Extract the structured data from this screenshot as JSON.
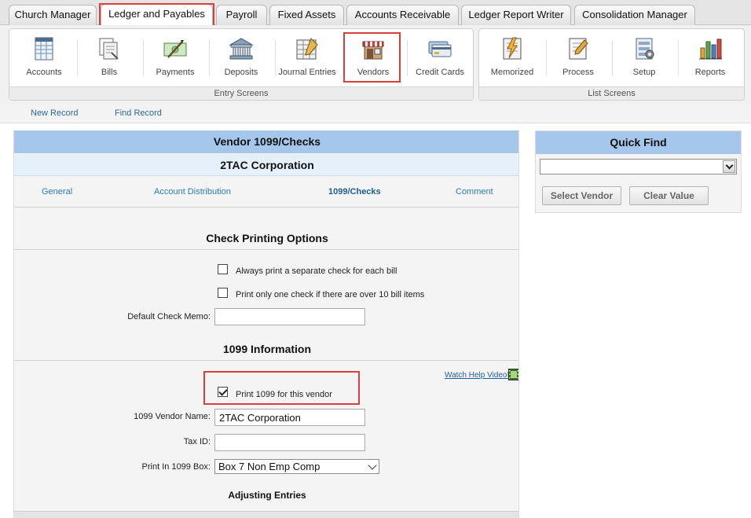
{
  "top_tabs": [
    {
      "label": "Church Manager"
    },
    {
      "label": "Ledger and Payables"
    },
    {
      "label": "Payroll"
    },
    {
      "label": "Fixed Assets"
    },
    {
      "label": "Accounts Receivable"
    },
    {
      "label": "Ledger Report Writer"
    },
    {
      "label": "Consolidation Manager"
    }
  ],
  "active_tab": "Ledger and Payables",
  "ribbon": {
    "entry_screens": {
      "label": "Entry Screens",
      "buttons": [
        {
          "label": "Accounts",
          "icon": "accounts-icon"
        },
        {
          "label": "Bills",
          "icon": "bills-icon"
        },
        {
          "label": "Payments",
          "icon": "payments-icon"
        },
        {
          "label": "Deposits",
          "icon": "deposits-icon"
        },
        {
          "label": "Journal Entries",
          "icon": "journal-entries-icon"
        },
        {
          "label": "Vendors",
          "icon": "vendors-icon"
        },
        {
          "label": "Credit Cards",
          "icon": "credit-cards-icon"
        }
      ]
    },
    "list_screens": {
      "label": "List Screens",
      "buttons": [
        {
          "label": "Memorized",
          "icon": "memorized-icon"
        },
        {
          "label": "Process",
          "icon": "process-icon"
        },
        {
          "label": "Setup",
          "icon": "setup-icon"
        },
        {
          "label": "Reports",
          "icon": "reports-icon"
        }
      ]
    }
  },
  "subbar": {
    "new_record": "New Record",
    "find_record": "Find Record"
  },
  "form": {
    "title": "Vendor 1099/Checks",
    "subtitle": "2TAC Corporation",
    "tabs": [
      {
        "label": "General"
      },
      {
        "label": "Account Distribution"
      },
      {
        "label": "1099/Checks"
      },
      {
        "label": "Comment"
      }
    ],
    "active_tab": "1099/Checks",
    "check_printing": {
      "heading": "Check Printing Options",
      "separate_check_label": "Always print a separate check for each bill",
      "separate_check_checked": false,
      "one_check_label": "Print only one check if there are over 10 bill items",
      "one_check_checked": false,
      "memo_label": "Default Check Memo:",
      "memo_value": ""
    },
    "info_1099": {
      "heading": "1099 Information",
      "help_link": "Watch Help Video!",
      "print_label": "Print 1099 for this vendor",
      "print_checked": true,
      "vendor_name_label": "1099 Vendor Name:",
      "vendor_name_value": "2TAC Corporation",
      "tax_id_label": "Tax ID:",
      "tax_id_value": "",
      "box_label": "Print In 1099 Box:",
      "box_value": "Box 7 Non Emp Comp",
      "adjusting_heading": "Adjusting Entries"
    }
  },
  "quick_find": {
    "title": "Quick Find",
    "select_value": "",
    "select_vendor": "Select Vendor",
    "clear_value": "Clear Value"
  },
  "colors": {
    "header_blue": "#a6c7ec",
    "subheader_blue": "#e6f0fb",
    "link_blue": "#2b7bb9",
    "highlight_red": "#d9403a"
  }
}
